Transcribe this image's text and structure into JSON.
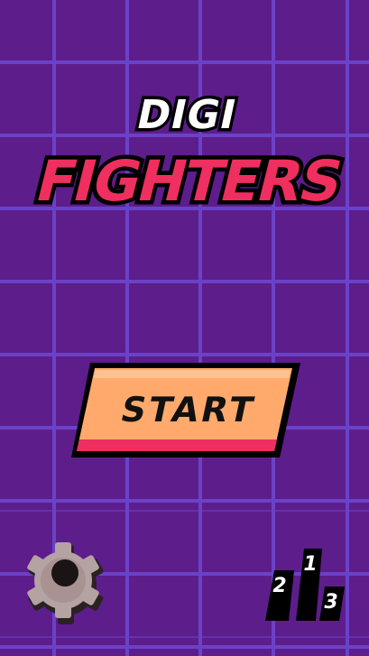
{
  "title": {
    "line1": "DIGI",
    "line2": "FIGHTERS"
  },
  "start_button": {
    "label": "START"
  },
  "leaderboard": {
    "places": [
      "2",
      "1",
      "3"
    ]
  },
  "colors": {
    "background": "#5d1d8b",
    "grid": "#6a42c8",
    "title_pink": "#ef2f5f",
    "button_orange": "#ffaa6c",
    "button_shadow": "#ef2f5f",
    "outline": "#000000"
  },
  "icons": {
    "settings": "gear-icon",
    "leaderboard": "podium-icon"
  }
}
